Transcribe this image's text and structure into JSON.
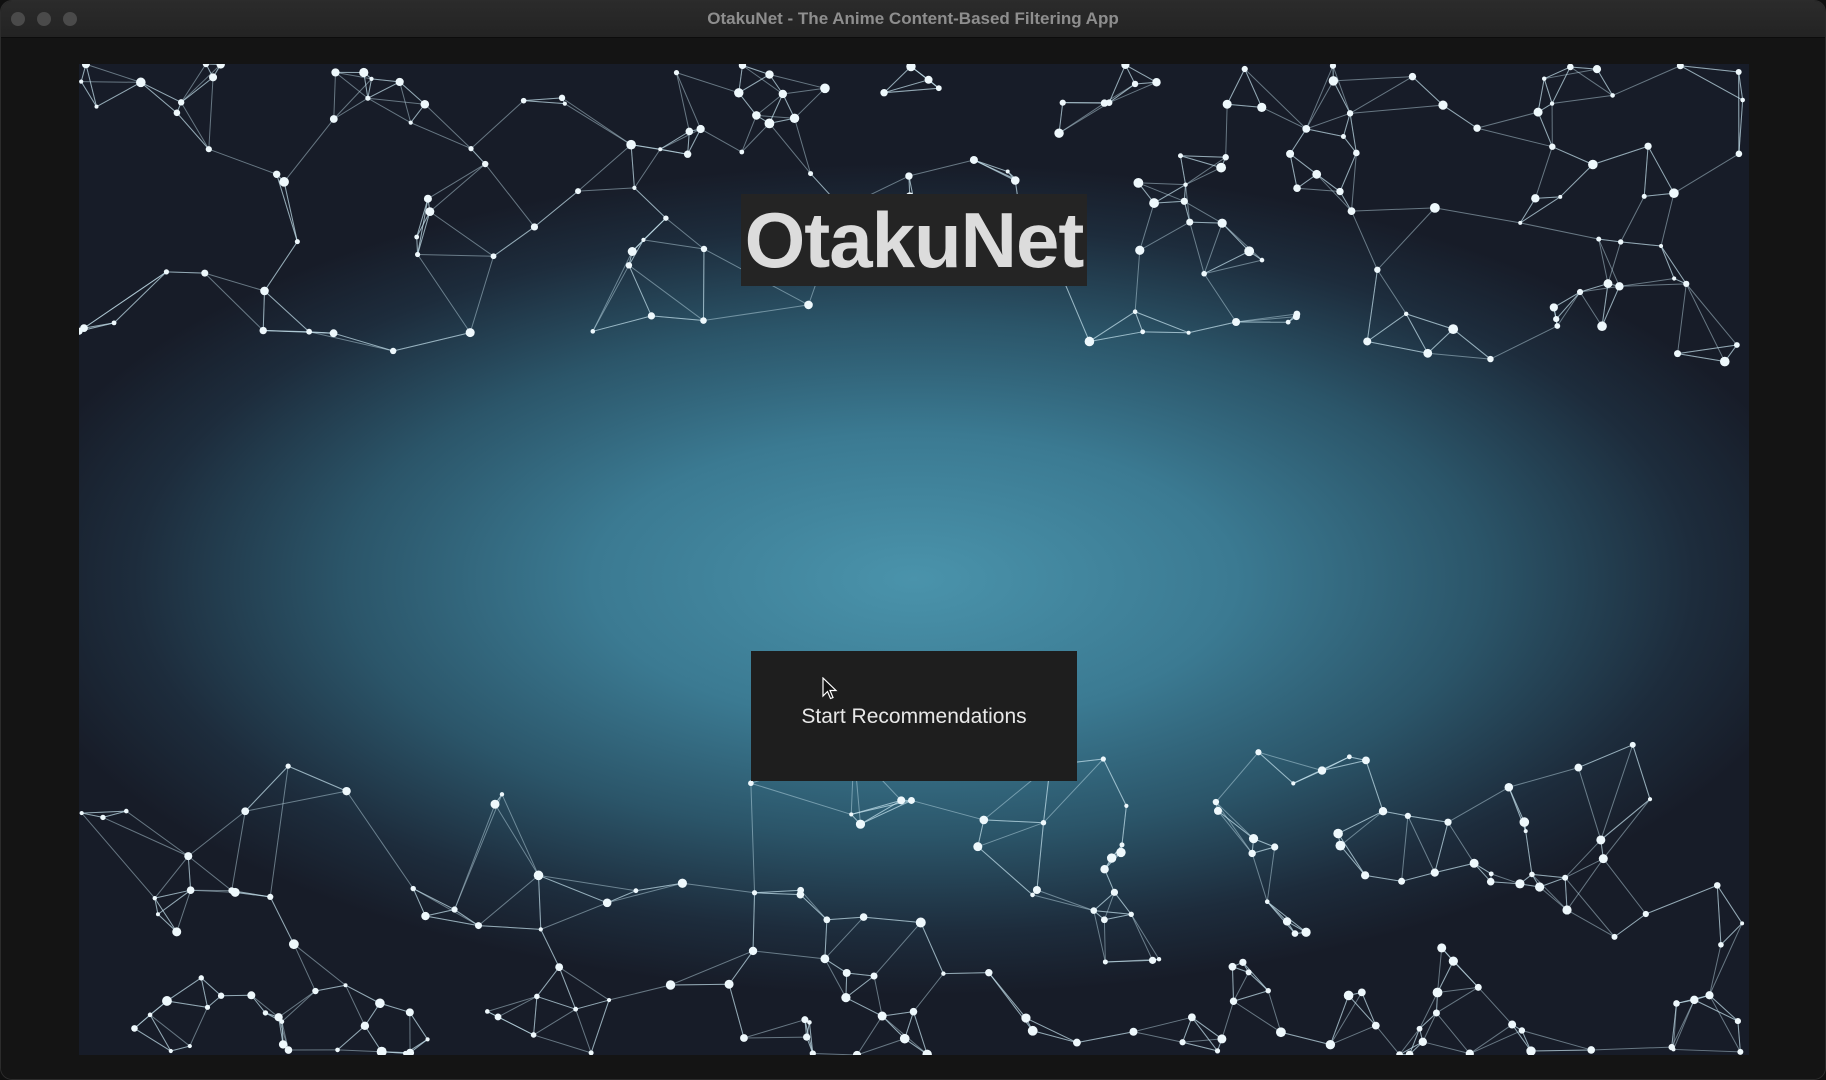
{
  "window": {
    "title": "OtakuNet - The Anime Content-Based Filtering App"
  },
  "main": {
    "app_title": "OtakuNet",
    "start_button_label": "Start Recommendations",
    "background_image": "plexus-network-background"
  },
  "colors": {
    "title_background": "#242424",
    "button_background": "#1e1e1e",
    "background_center": "#4a93ab",
    "background_edge": "#171c28"
  }
}
